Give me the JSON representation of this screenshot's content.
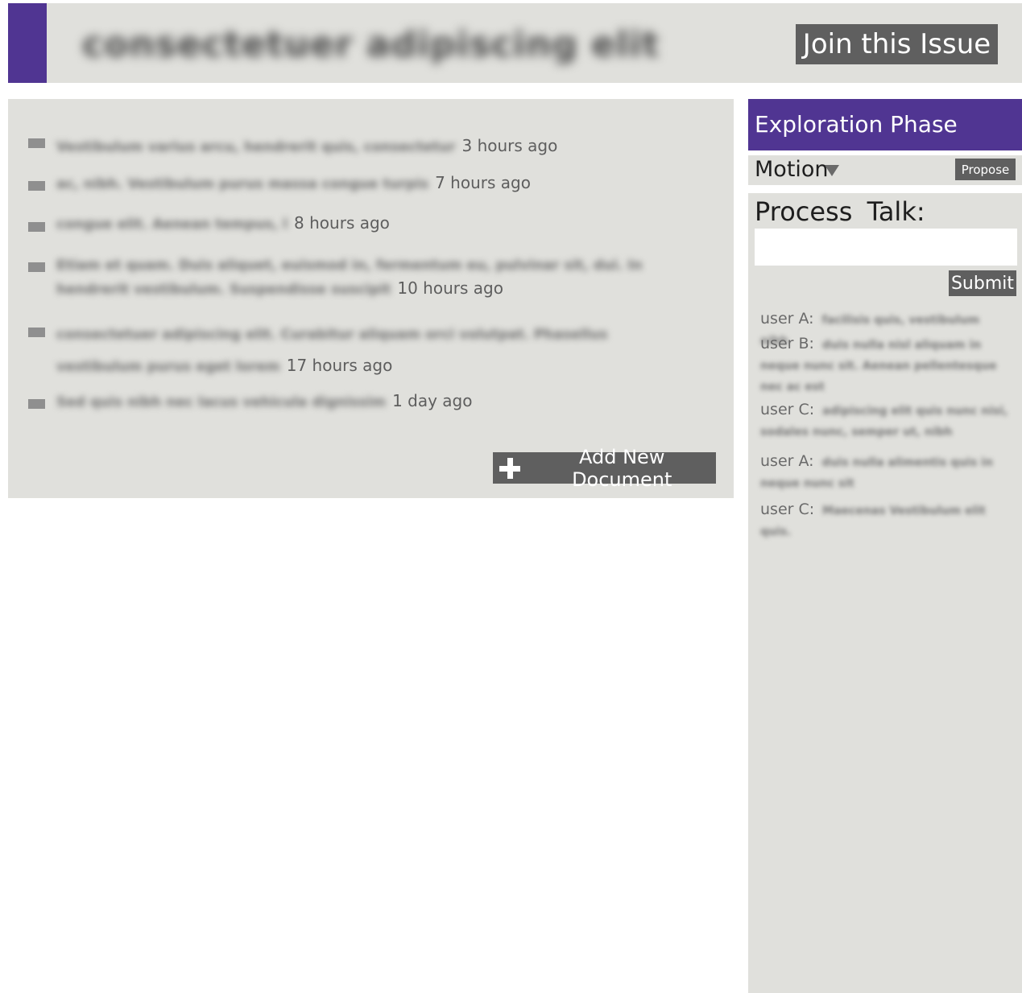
{
  "header": {
    "title": "consectetuer adipiscing elit",
    "join_label": "Join this Issue"
  },
  "documents": {
    "items": [
      {
        "title": "Vestibulum varius arcu, hendrerit quis, consectetur",
        "time": "3 hours ago"
      },
      {
        "title": "ac, nibh. Vestibulum purus massa congue turpis",
        "time": "7 hours ago"
      },
      {
        "title": "congue elit. Aenean tempus, l",
        "time": "8 hours ago"
      },
      {
        "title": "Etiam et quam. Duis aliquet, euismod in, fermentum eu, pulvinar sit, dui. In hendrerit vestibulum. Suspendisse suscipit",
        "time": "10 hours ago"
      },
      {
        "title": "consectetuer adipiscing elit. Curabitur aliquam orci volutpat. Phasellus vestibulum purus eget lorem",
        "time": "17 hours ago"
      },
      {
        "title": "Sed quis nibh nec lacus vehicula dignissim",
        "time": "1 day ago"
      }
    ],
    "add_label": "Add New Document"
  },
  "sidebar": {
    "phase_title": "Exploration Phase",
    "motion_label": "Motion",
    "propose_label": "Propose",
    "talk_title": "Process Talk:",
    "talk_input_value": "",
    "submit_label": "Submit",
    "messages": [
      {
        "user": "user A:",
        "text": "facilisis quis, vestibulum nibh"
      },
      {
        "user": "user B:",
        "text": "duis nulla nisl aliquam in neque nunc sit. Aenean pellentesque nec ac est"
      },
      {
        "user": "user C:",
        "text": "adipiscing elit quis nunc nisi, sodales nunc, semper ut, nibh"
      },
      {
        "user": "user A:",
        "text": "duis nulla alimentis quis in neque nunc sit"
      },
      {
        "user": "user C:",
        "text": "Maecenas Vestibulum elit quis."
      }
    ]
  },
  "colors": {
    "accent": "#503592",
    "panel": "#e0e0dc",
    "button": "#5f5f5f"
  }
}
